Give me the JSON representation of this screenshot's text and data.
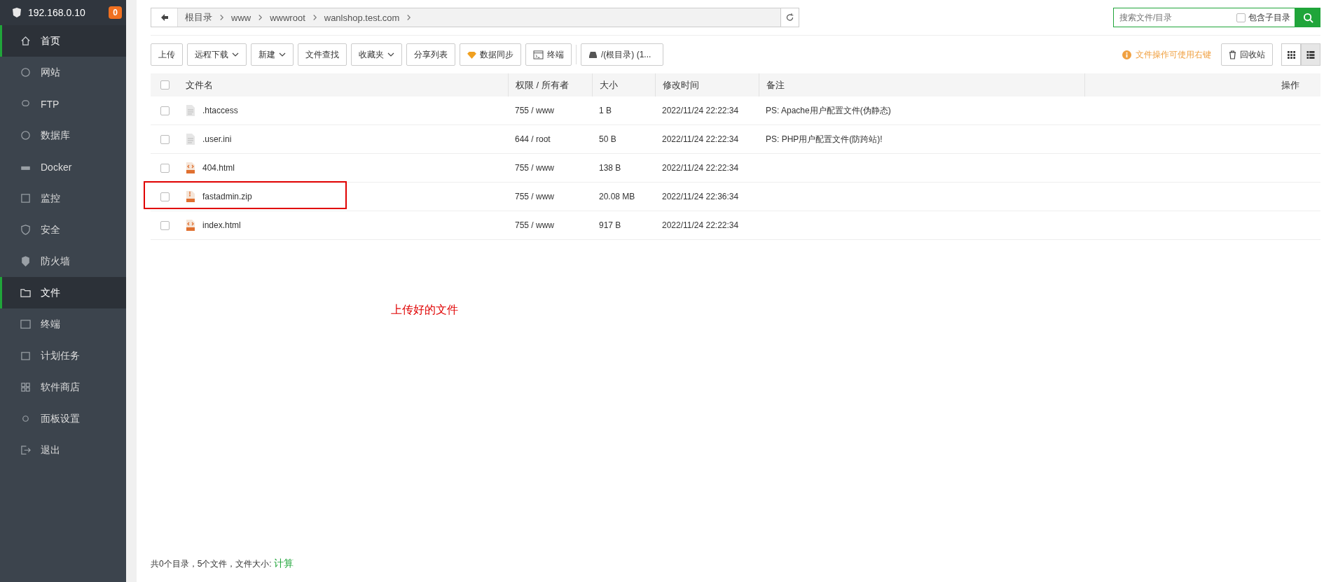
{
  "sidebar": {
    "host": "192.168.0.10",
    "badge": "0",
    "items": [
      {
        "label": "首页",
        "selected": true
      },
      {
        "label": "网站",
        "selected": false
      },
      {
        "label": "FTP",
        "selected": false
      },
      {
        "label": "数据库",
        "selected": false
      },
      {
        "label": "Docker",
        "selected": false
      },
      {
        "label": "监控",
        "selected": false
      },
      {
        "label": "安全",
        "selected": false
      },
      {
        "label": "防火墙",
        "selected": false
      },
      {
        "label": "文件",
        "selected": true
      },
      {
        "label": "终端",
        "selected": false
      },
      {
        "label": "计划任务",
        "selected": false
      },
      {
        "label": "软件商店",
        "selected": false
      },
      {
        "label": "面板设置",
        "selected": false
      },
      {
        "label": "退出",
        "selected": false
      }
    ]
  },
  "breadcrumb": [
    "根目录",
    "www",
    "wwwroot",
    "wanlshop.test.com"
  ],
  "search": {
    "placeholder": "搜索文件/目录",
    "include_subdirs_label": "包含子目录",
    "include_subdirs_checked": false
  },
  "toolbar": [
    {
      "label": "上传",
      "kind": "plain"
    },
    {
      "label": "远程下载",
      "kind": "dropdown"
    },
    {
      "label": "新建",
      "kind": "dropdown"
    },
    {
      "label": "文件查找",
      "kind": "plain"
    },
    {
      "label": "收藏夹",
      "kind": "dropdown"
    },
    {
      "label": "分享列表",
      "kind": "plain"
    },
    {
      "label": "数据同步",
      "kind": "gem"
    },
    {
      "label": "终端",
      "kind": "terminal"
    },
    {
      "label": "/(根目录) (1...",
      "kind": "disk"
    }
  ],
  "hint": "文件操作可使用右键",
  "recycle_label": "回收站",
  "view_mode": {
    "grid_selected": false,
    "list_selected": true
  },
  "table": {
    "select_all_checked": false,
    "columns": [
      "文件名",
      "权限 / 所有者",
      "大小",
      "修改时间",
      "备注",
      "操作"
    ],
    "rows": [
      {
        "name": ".htaccess",
        "kind": "text",
        "perms": "755 / www",
        "size": "1 B",
        "modified": "2022/11/24 22:22:34",
        "note": "PS: Apache用户配置文件(伪静态)",
        "checked": false,
        "highlighted": false
      },
      {
        "name": ".user.ini",
        "kind": "text",
        "perms": "644 / root",
        "size": "50 B",
        "modified": "2022/11/24 22:22:34",
        "note": "PS: PHP用户配置文件(防跨站)!",
        "checked": false,
        "highlighted": false
      },
      {
        "name": "404.html",
        "kind": "html",
        "perms": "755 / www",
        "size": "138 B",
        "modified": "2022/11/24 22:22:34",
        "checked": false,
        "highlighted": false
      },
      {
        "name": "fastadmin.zip",
        "kind": "zip",
        "perms": "755 / www",
        "size": "20.08 MB",
        "modified": "2022/11/24 22:36:34",
        "checked": false,
        "highlighted": true
      },
      {
        "name": "index.html",
        "kind": "html",
        "perms": "755 / www",
        "size": "917 B",
        "modified": "2022/11/24 22:22:34",
        "checked": false,
        "highlighted": false
      }
    ]
  },
  "annotation": "上传好的文件",
  "footer": {
    "summary": "共0个目录，5个文件，文件大小: ",
    "link": "计算"
  }
}
